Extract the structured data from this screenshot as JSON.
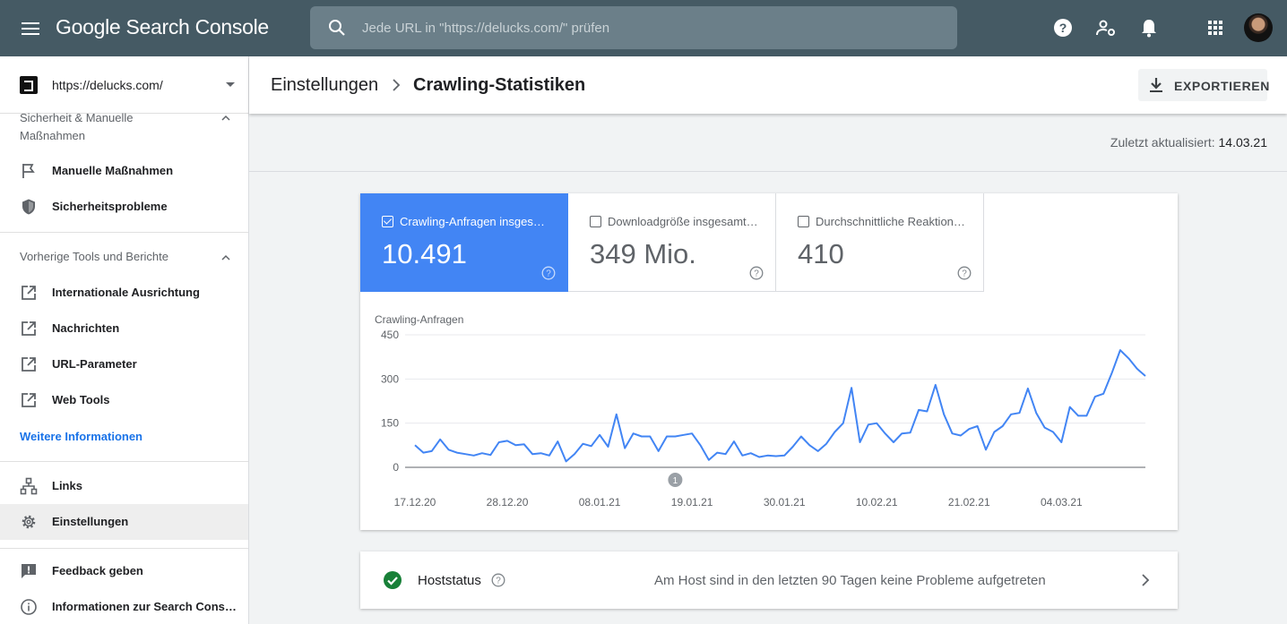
{
  "topbar": {
    "brand": "Google Search Console",
    "search_placeholder": "Jede URL in \"https://delucks.com/\" prüfen",
    "icons": [
      "menu-icon",
      "search-icon",
      "help-icon",
      "manage-users-icon",
      "notifications-icon",
      "apps-icon",
      "avatar"
    ],
    "bg_color": "#455a64"
  },
  "sidebar": {
    "property_url": "https://delucks.com/",
    "section_security": "Sicherheit & Manuelle Maßnahmen",
    "security_items": [
      {
        "label": "Manuelle Maßnahmen",
        "icon": "flag-icon"
      },
      {
        "label": "Sicherheitsprobleme",
        "icon": "shield-icon"
      }
    ],
    "section_legacy": "Vorherige Tools und Berichte",
    "legacy_items": [
      {
        "label": "Internationale Ausrichtung",
        "icon": "external-link-icon"
      },
      {
        "label": "Nachrichten",
        "icon": "external-link-icon"
      },
      {
        "label": "URL-Parameter",
        "icon": "external-link-icon"
      },
      {
        "label": "Web Tools",
        "icon": "external-link-icon"
      }
    ],
    "more_info": "Weitere Informationen",
    "main_items": [
      {
        "label": "Links",
        "icon": "sitemap-icon"
      },
      {
        "label": "Einstellungen",
        "icon": "gear-icon",
        "active": true
      }
    ],
    "footer_items": [
      {
        "label": "Feedback geben",
        "icon": "feedback-icon"
      },
      {
        "label": "Informationen zur Search Cons…",
        "icon": "info-icon"
      }
    ]
  },
  "header": {
    "breadcrumb_parent": "Einstellungen",
    "breadcrumb_current": "Crawling-Statistiken",
    "export_label": "EXPORTIEREN"
  },
  "updated": {
    "label": "Zuletzt aktualisiert:",
    "date": "14.03.21"
  },
  "metrics": [
    {
      "label": "Crawling-Anfragen insgesa…",
      "value": "10.491",
      "checked": true
    },
    {
      "label": "Downloadgröße insgesamt…",
      "value": "349 Mio.",
      "checked": false
    },
    {
      "label": "Durchschnittliche Reaktion…",
      "value": "410",
      "checked": false
    }
  ],
  "accent_color": "#4285f4",
  "chart_data": {
    "type": "line",
    "ylabel": "Crawling-Anfragen",
    "ylim": [
      0,
      450
    ],
    "yticks": [
      0,
      150,
      300,
      450
    ],
    "x_tick_labels": [
      "17.12.20",
      "28.12.20",
      "08.01.21",
      "19.01.21",
      "30.01.21",
      "10.02.21",
      "21.02.21",
      "04.03.21"
    ],
    "annotation": "1",
    "annotation_index": 31,
    "grid": true,
    "series": [
      {
        "color": "#4285f4",
        "values": [
          75,
          50,
          55,
          95,
          60,
          50,
          45,
          40,
          48,
          42,
          85,
          90,
          75,
          78,
          45,
          48,
          40,
          88,
          20,
          45,
          80,
          72,
          110,
          70,
          180,
          65,
          115,
          105,
          105,
          55,
          105,
          105,
          110,
          115,
          75,
          25,
          50,
          45,
          88,
          40,
          48,
          35,
          40,
          38,
          40,
          70,
          105,
          75,
          55,
          80,
          120,
          150,
          270,
          85,
          145,
          150,
          115,
          85,
          115,
          118,
          195,
          190,
          280,
          180,
          115,
          108,
          130,
          140,
          60,
          120,
          140,
          180,
          185,
          268,
          185,
          135,
          120,
          85,
          205,
          175,
          175,
          240,
          250,
          320,
          398,
          370,
          335,
          310
        ]
      }
    ]
  },
  "host_status": {
    "title": "Hoststatus",
    "message": "Am Host sind in den letzten 90 Tagen keine Probleme aufgetreten",
    "status_icon": "check-circle-icon",
    "status_color": "#188038"
  }
}
